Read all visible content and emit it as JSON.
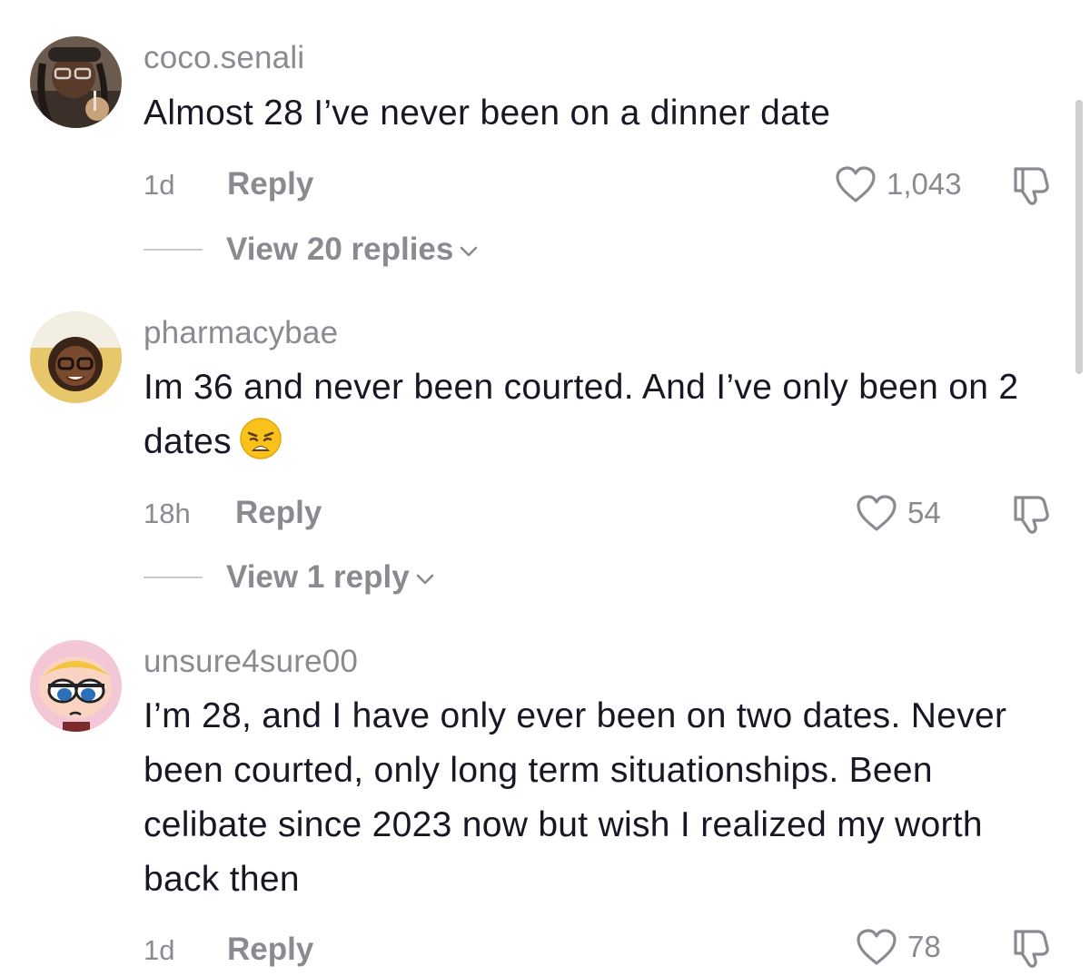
{
  "comments": [
    {
      "username": "coco.senali",
      "text": "Almost 28 I’ve never been on a dinner date",
      "time": "1d",
      "reply_label": "Reply",
      "likes": "1,043",
      "view_replies": "View 20 replies"
    },
    {
      "username": "pharmacybae",
      "text": "Im 36 and never been courted. And I’ve only been on 2 dates",
      "emoji": "weary-face",
      "time": "18h",
      "reply_label": "Reply",
      "likes": "54",
      "view_replies": "View 1 reply"
    },
    {
      "username": "unsure4sure00",
      "text": "I’m 28, and I have only ever been on two dates. Never been courted, only long term situationships. Been celibate since 2023 now but wish I realized my worth back then",
      "time": "1d",
      "reply_label": "Reply",
      "likes": "78"
    }
  ],
  "icons": {
    "like": "heart-outline-icon",
    "dislike": "thumbs-down-icon",
    "expand": "chevron-down-icon"
  },
  "colors": {
    "text": "#161823",
    "secondary": "#8a8b91"
  }
}
